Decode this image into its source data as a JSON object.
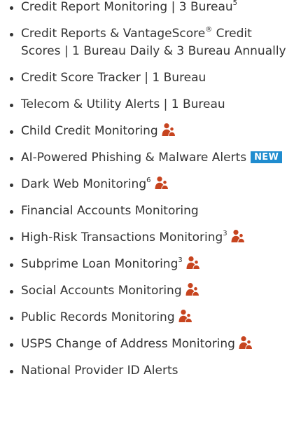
{
  "accent_color": "#c7441f",
  "badge_color": "#1f8ccf",
  "features": [
    {
      "text": "Credit Report Monitoring | 3 Bureau",
      "sup": "5",
      "icon": null,
      "badge": null
    },
    {
      "text": "Credit Reports & VantageScore",
      "sup": "®",
      "text2": " Credit Scores | 1 Bureau Daily & 3 Bureau Annually",
      "icon": null,
      "badge": null
    },
    {
      "text": "Credit Score Tracker | 1 Bureau",
      "sup": null,
      "icon": null,
      "badge": null
    },
    {
      "text": "Telecom & Utility Alerts | 1 Bureau",
      "sup": null,
      "icon": null,
      "badge": null
    },
    {
      "text": "Child Credit Monitoring",
      "sup": null,
      "icon": "family-icon",
      "badge": null
    },
    {
      "text": "AI-Powered Phishing & Malware Alerts",
      "sup": null,
      "icon": null,
      "badge": "NEW"
    },
    {
      "text": "Dark Web Monitoring",
      "sup": "6",
      "icon": "family-icon",
      "badge": null
    },
    {
      "text": "Financial Accounts Monitoring",
      "sup": null,
      "icon": null,
      "badge": null
    },
    {
      "text": "High-Risk Transactions Monitoring",
      "sup": "3",
      "icon": "family-icon",
      "badge": null
    },
    {
      "text": "Subprime Loan Monitoring",
      "sup": "3",
      "icon": "family-icon",
      "badge": null
    },
    {
      "text": "Social Accounts Monitoring",
      "sup": null,
      "icon": "family-icon",
      "badge": null
    },
    {
      "text": "Public Records Monitoring",
      "sup": null,
      "icon": "family-icon",
      "badge": null
    },
    {
      "text": "USPS Change of Address Monitoring",
      "sup": null,
      "icon": "family-icon",
      "badge": null
    },
    {
      "text": "National Provider ID Alerts",
      "sup": null,
      "icon": null,
      "badge": null
    }
  ]
}
